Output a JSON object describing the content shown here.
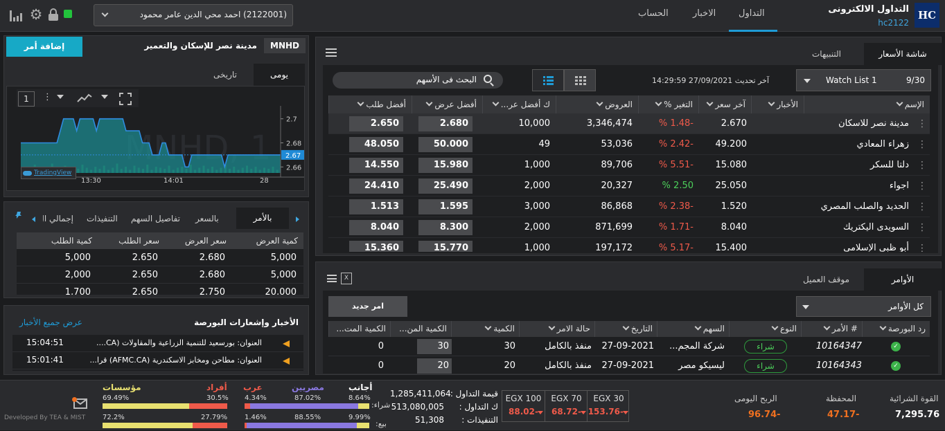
{
  "app": {
    "title": "التداول الالكترونى",
    "code": "hc2122",
    "logo": "HC"
  },
  "nav": {
    "tabs": [
      "التداول",
      "الاخبار",
      "الحساب"
    ],
    "active": 0
  },
  "account": {
    "selector": "(2122001) احمد محي الدين عامر محمود"
  },
  "symbol": {
    "code": "MNHD",
    "name": "مدينة نصر للإسكان والتعمير",
    "add_order": "إضافة أمر"
  },
  "chart": {
    "tabs": [
      "يومى",
      "تاريخى"
    ],
    "interval": "1",
    "watermark": "MNHD, 1",
    "prices": [
      "2.7",
      "2.68",
      "2.67",
      "2.66"
    ],
    "times": [
      "13:30",
      "14:01",
      "28"
    ],
    "provider": "TradingView"
  },
  "chart_data": {
    "type": "area",
    "ylim": [
      2.655,
      2.705
    ],
    "current": 2.67,
    "y_ticks": [
      2.7,
      2.68,
      2.67,
      2.66
    ],
    "x_ticks": [
      "13:30",
      "14:01",
      "28"
    ],
    "values": [
      2.68,
      2.68,
      2.68,
      2.68,
      2.68,
      2.68,
      2.68,
      2.68,
      2.68,
      2.68,
      2.68,
      2.68,
      2.69,
      2.7,
      2.7,
      2.7,
      2.7,
      2.69,
      2.7,
      2.7,
      2.7,
      2.7,
      2.7,
      2.69,
      2.7,
      2.7,
      2.7,
      2.7,
      2.7,
      2.7,
      2.7,
      2.7,
      2.69,
      2.69,
      2.69,
      2.69,
      2.69,
      2.68,
      2.68,
      2.68,
      2.67,
      2.67,
      2.67,
      2.68,
      2.68,
      2.67,
      2.67,
      2.67,
      2.67,
      2.67,
      2.66,
      2.66,
      2.67,
      2.67,
      2.67,
      2.67,
      2.67,
      2.67,
      2.67,
      2.67,
      2.67,
      2.67,
      2.66,
      2.67,
      2.67,
      2.67,
      2.67,
      2.67,
      2.67,
      2.67,
      2.67,
      2.67,
      2.67,
      2.67,
      2.67,
      2.67,
      2.67,
      2.67,
      2.67,
      2.67
    ]
  },
  "depth": {
    "tabs": [
      "بالأمر",
      "بالسعر",
      "تفاصيل السهم",
      "التنفيذات",
      "إجمالي ال"
    ],
    "headers": [
      "كمية العرض",
      "سعر العرض",
      "سعر الطلب",
      "كمية الطلب"
    ],
    "rows": [
      [
        "5,000",
        "2.680",
        "2.650",
        "5,000"
      ],
      [
        "5,000",
        "2.680",
        "2.650",
        "2,000"
      ],
      [
        "20,000",
        "2.750",
        "2.650",
        "1,700"
      ]
    ]
  },
  "news": {
    "title": "الأخبار وإشعارات البورصة",
    "view_all": "عرض جميع الأخبار",
    "items": [
      {
        "text": "العنوان: بورسعيد للتنمية الزراعية والمقاولات (CA....",
        "time": "15:04:51"
      },
      {
        "text": "العنوان: مطاحن ومخابز الاسكندرية (AFMC.CA) قرا...",
        "time": "15:01:41"
      }
    ]
  },
  "watchlist": {
    "tabs": [
      "شاشة الأسعار",
      "التنبيهات"
    ],
    "list_name": "Watch List 1",
    "count": "9/30",
    "last_update": "آخر تحديث 27/09/2021 14:29:59",
    "search_placeholder": "البحث فى الأسهم",
    "headers": [
      "الإسم",
      "الأخبار",
      "آخر سعر",
      "التغير %",
      "العروض",
      "ك أفضل عر...",
      "أفضل عرض",
      "أفضل طلب"
    ],
    "rows": [
      {
        "name": "مدينة نصر للاسكان",
        "last": "2.670",
        "change": "-1.48 %",
        "up": false,
        "offers": "3,346,474",
        "best_ask_qty": "10,000",
        "best_ask": "2.680",
        "best_bid": "2.650"
      },
      {
        "name": "زهراء المعادي",
        "last": "49.200",
        "change": "-2.42 %",
        "up": false,
        "offers": "53,036",
        "best_ask_qty": "49",
        "best_ask": "50.000",
        "best_bid": "48.050"
      },
      {
        "name": "دلتا للسكر",
        "last": "15.080",
        "change": "-5.51 %",
        "up": false,
        "offers": "89,706",
        "best_ask_qty": "1,000",
        "best_ask": "15.980",
        "best_bid": "14.550"
      },
      {
        "name": "اجواء",
        "last": "25.050",
        "change": "2.50 %",
        "up": true,
        "offers": "20,327",
        "best_ask_qty": "2,000",
        "best_ask": "25.490",
        "best_bid": "24.410"
      },
      {
        "name": "الحديد والصلب المصري",
        "last": "1.520",
        "change": "-2.38 %",
        "up": false,
        "offers": "86,868",
        "best_ask_qty": "3,000",
        "best_ask": "1.595",
        "best_bid": "1.513"
      },
      {
        "name": "السويدى اليكتريك",
        "last": "8.040",
        "change": "-1.71 %",
        "up": false,
        "offers": "871,699",
        "best_ask_qty": "2,000",
        "best_ask": "8.300",
        "best_bid": "8.040"
      },
      {
        "name": "أبو ظبي الإسلامي",
        "last": "15.400",
        "change": "-5.17 %",
        "up": false,
        "offers": "197,172",
        "best_ask_qty": "1,000",
        "best_ask": "15.770",
        "best_bid": "15.360"
      }
    ]
  },
  "orders": {
    "tabs": [
      "الأوامر",
      "موقف العميل"
    ],
    "new_order": "امر جديد",
    "filter": "كل الأوامر",
    "headers": [
      "رد البورصة",
      "# الأمر",
      "النوع",
      "السهم",
      "التاريخ",
      "حالة الامر",
      "الكمية",
      "الكمية المن...",
      "الكمية المت..."
    ],
    "rows": [
      {
        "order_no": "10164347",
        "type": "شراء",
        "stock": "شركة المجم...",
        "date": "27-09-2021",
        "status": "منفذ بالكامل",
        "qty": "30",
        "executed": "30",
        "remaining": "0"
      },
      {
        "order_no": "10164343",
        "type": "شراء",
        "stock": "ليسيكو مصر",
        "date": "27-09-2021",
        "status": "منفذ بالكامل",
        "qty": "20",
        "executed": "20",
        "remaining": "0"
      }
    ]
  },
  "footer": {
    "credit": "Developed By TEA & MIST",
    "buying_power_label": "القوة الشرائية",
    "buying_power": "7,295.76",
    "portfolio_label": "المحفظة",
    "portfolio": "-47.17",
    "daily_profit_label": "الربح اليومى",
    "daily_profit": "-96.74",
    "indices": [
      {
        "name": "EGX 30",
        "value": "-153.76"
      },
      {
        "name": "EGX 70",
        "value": "-68.72"
      },
      {
        "name": "EGX 100",
        "value": "-88.02"
      }
    ],
    "market": [
      {
        "label": "قيمة التداول :",
        "value": "1,285,411,064"
      },
      {
        "label": "ك التداول :",
        "value": "513,080,005"
      },
      {
        "label": "التنفيذات :",
        "value": "51,308"
      }
    ],
    "buy_label": "شراء:",
    "sell_label": "بيع:",
    "groups": [
      {
        "left": "أجانب",
        "right": "مصريين",
        "buy": [
          "8.64%",
          "87.02%"
        ],
        "sell": [
          "9.99%",
          "88.55%"
        ]
      },
      {
        "left": "عرب",
        "right": "",
        "buy": [
          "4.34%"
        ],
        "sell": [
          "1.46%"
        ]
      },
      {
        "left": "أفراد",
        "right": "مؤسسات",
        "buy": [
          "30.5%",
          "69.49%"
        ],
        "sell": [
          "27.79%",
          "72.2%"
        ]
      }
    ],
    "group_buy_fractions": [
      0.0864,
      0.8702,
      0.0434
    ],
    "group_sell_fractions": [
      0.0999,
      0.8855,
      0.0146
    ],
    "inst_buy_fraction": 0.6949,
    "inst_sell_fraction": 0.722
  },
  "colors": {
    "accent": "#1f9bd6",
    "add_order": "#17a9c6",
    "up": "#4ccf5a",
    "down": "#ef5a4a",
    "warn": "#f0a020",
    "buy_badge": "#2e9a3d"
  }
}
